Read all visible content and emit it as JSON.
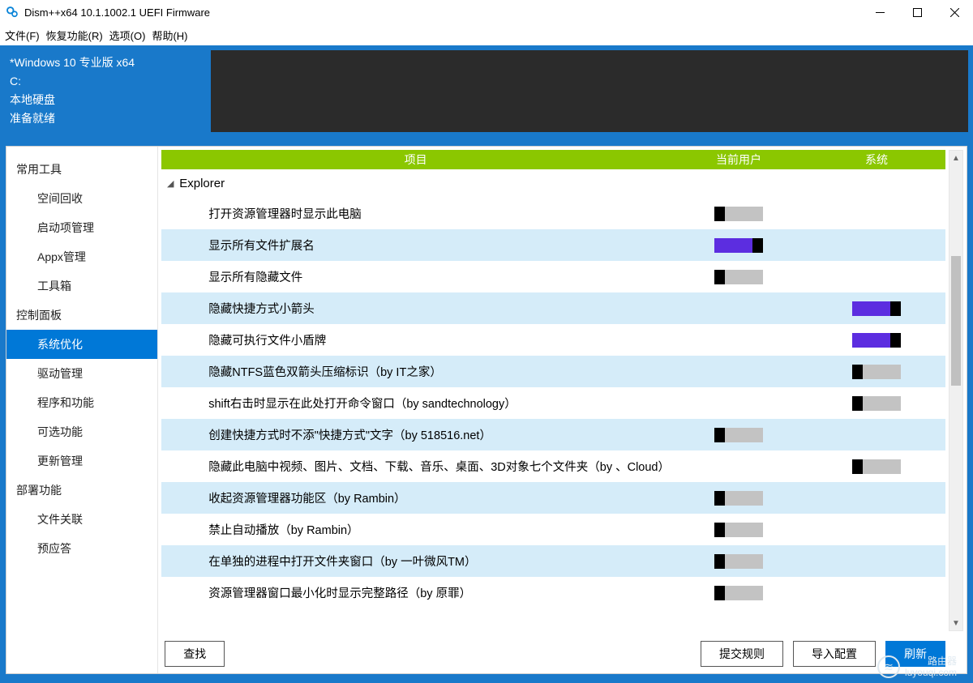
{
  "title": "Dism++x64 10.1.1002.1 UEFI Firmware",
  "menu": {
    "file": "文件(F)",
    "recover": "恢复功能(R)",
    "options": "选项(O)",
    "help": "帮助(H)"
  },
  "info": {
    "os": "*Windows 10 专业版 x64",
    "drive": "C:",
    "storage": "本地硬盘",
    "status": "准备就绪"
  },
  "sidebar": {
    "group1": "常用工具",
    "g1_items": [
      "空间回收",
      "启动项管理",
      "Appx管理",
      "工具箱"
    ],
    "group2": "控制面板",
    "g2_items": [
      "系统优化",
      "驱动管理",
      "程序和功能",
      "可选功能",
      "更新管理"
    ],
    "group3": "部署功能",
    "g3_items": [
      "文件关联",
      "预应答"
    ],
    "selected": "系统优化"
  },
  "columns": {
    "project": "项目",
    "user": "当前用户",
    "system": "系统"
  },
  "groupName": "Explorer",
  "rows": [
    {
      "label": "打开资源管理器时显示此电脑",
      "user": "off",
      "system": null
    },
    {
      "label": "显示所有文件扩展名",
      "user": "on",
      "system": null
    },
    {
      "label": "显示所有隐藏文件",
      "user": "off",
      "system": null
    },
    {
      "label": "隐藏快捷方式小箭头",
      "user": null,
      "system": "on"
    },
    {
      "label": "隐藏可执行文件小盾牌",
      "user": null,
      "system": "on"
    },
    {
      "label": "隐藏NTFS蓝色双箭头压缩标识（by IT之家）",
      "user": null,
      "system": "off"
    },
    {
      "label": "shift右击时显示在此处打开命令窗口（by sandtechnology）",
      "user": null,
      "system": "off"
    },
    {
      "label": "创建快捷方式时不添\"快捷方式\"文字（by 518516.net）",
      "user": "off",
      "system": null
    },
    {
      "label": "隐藏此电脑中视频、图片、文档、下载、音乐、桌面、3D对象七个文件夹（by 、Cloud）",
      "user": null,
      "system": "off"
    },
    {
      "label": "收起资源管理器功能区（by Rambin）",
      "user": "off",
      "system": null
    },
    {
      "label": "禁止自动播放（by Rambin）",
      "user": "off",
      "system": null
    },
    {
      "label": "在单独的进程中打开文件夹窗口（by 一叶微风TM）",
      "user": "off",
      "system": null
    },
    {
      "label": "资源管理器窗口最小化时显示完整路径（by 原罪）",
      "user": "off",
      "system": null
    }
  ],
  "buttons": {
    "find": "查找",
    "submit": "提交规则",
    "import": "导入配置",
    "refresh": "刷新"
  },
  "watermark": {
    "t1": "路由器",
    "t2": "luyouqi.com"
  }
}
